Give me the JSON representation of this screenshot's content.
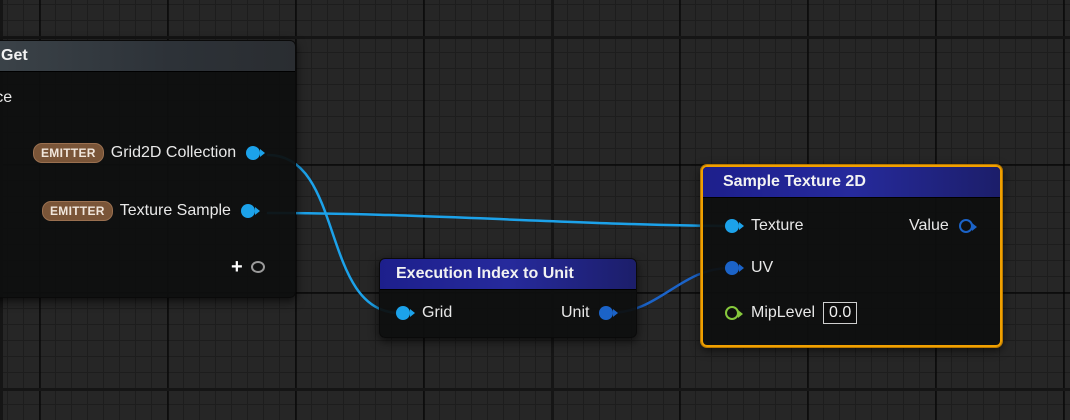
{
  "nodes": {
    "map_get": {
      "title": "Get",
      "source_label": "urce",
      "pins": [
        {
          "badge": "EMITTER",
          "label": "Grid2D Collection"
        },
        {
          "badge": "EMITTER",
          "label": "Texture Sample"
        }
      ],
      "add_pin_icon": "plus-icon"
    },
    "exec_index": {
      "title": "Execution Index to Unit",
      "input_label": "Grid",
      "output_label": "Unit"
    },
    "sample_texture": {
      "title": "Sample Texture 2D",
      "texture_label": "Texture",
      "value_label": "Value",
      "uv_label": "UV",
      "mip_label": "MipLevel",
      "mip_value": "0.0"
    }
  },
  "colors": {
    "selection_border": "#f0a000",
    "pin_light_blue": "#1ca2ea",
    "pin_dark_blue": "#1b63c8",
    "pin_green": "#86c83c",
    "emitter_badge": "#7a5538",
    "header_blue": "#262a9c"
  }
}
